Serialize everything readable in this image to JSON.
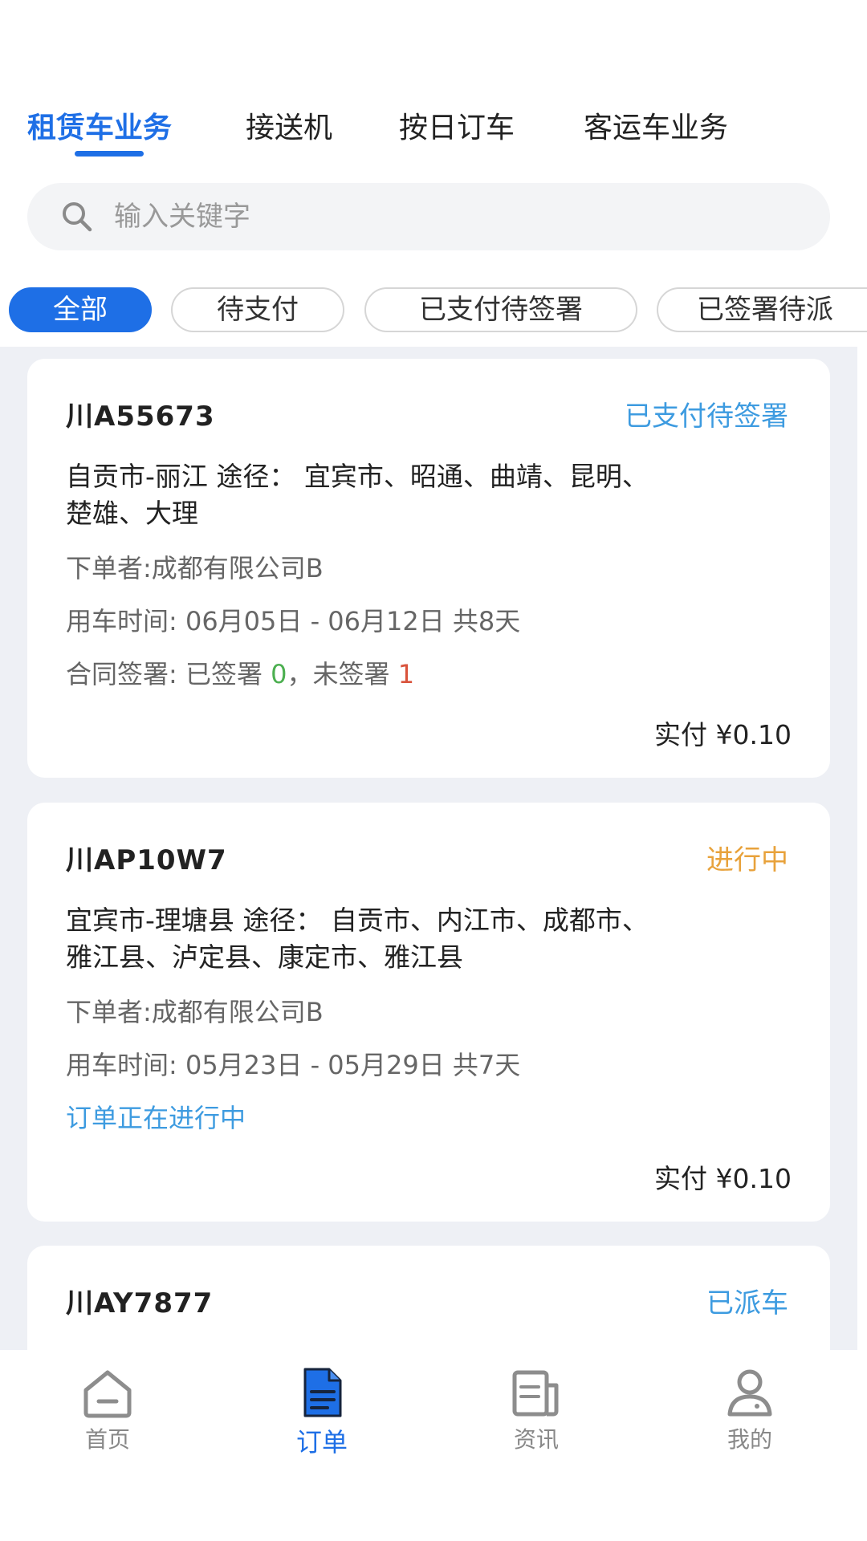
{
  "tabs": [
    {
      "label": "租赁车业务",
      "active": true
    },
    {
      "label": "接送机",
      "active": false
    },
    {
      "label": "按日订车",
      "active": false
    },
    {
      "label": "客运车业务",
      "active": false
    }
  ],
  "search": {
    "placeholder": "输入关键字",
    "value": ""
  },
  "filters": [
    {
      "label": "全部",
      "active": true
    },
    {
      "label": "待支付",
      "active": false
    },
    {
      "label": "已支付待签署",
      "active": false
    },
    {
      "label": "已签署待派",
      "active": false
    }
  ],
  "orders": [
    {
      "plate": "川A55673",
      "status": "已支付待签署",
      "route_line1": "自贡市-丽江 途径： 宜宾市、昭通、曲靖、昆明、",
      "route_line2": "楚雄、大理",
      "orderer": "下单者:成都有限公司B",
      "time": "用车时间: 06月05日 - 06月12日 共8天",
      "sign_prefix": "合同签署: 已签署 ",
      "signed": "0",
      "sign_mid": "，未签署 ",
      "unsigned": "1",
      "paid": "实付 ¥0.10"
    },
    {
      "plate": "川AP10W7",
      "status": "进行中",
      "route_line1": "宜宾市-理塘县 途径： 自贡市、内江市、成都市、",
      "route_line2": "雅江县、泸定县、康定市、雅江县",
      "orderer": "下单者:成都有限公司B",
      "time": "用车时间: 05月23日 - 05月29日 共7天",
      "note": "订单正在进行中",
      "paid": "实付 ¥0.10"
    },
    {
      "plate": "川AY7877",
      "status": "已派车"
    }
  ],
  "nav": [
    {
      "label": "首页",
      "icon": "home-icon",
      "active": false
    },
    {
      "label": "订单",
      "icon": "order-icon",
      "active": true
    },
    {
      "label": "资讯",
      "icon": "news-icon",
      "active": false
    },
    {
      "label": "我的",
      "icon": "profile-icon",
      "active": false
    }
  ],
  "colors": {
    "accent": "#1e6fe6",
    "status_blue": "#3d9be0",
    "status_orange": "#e8a23b",
    "signed_green": "#4caf50",
    "unsigned_red": "#d9533c",
    "list_background": "#eef0f5"
  }
}
